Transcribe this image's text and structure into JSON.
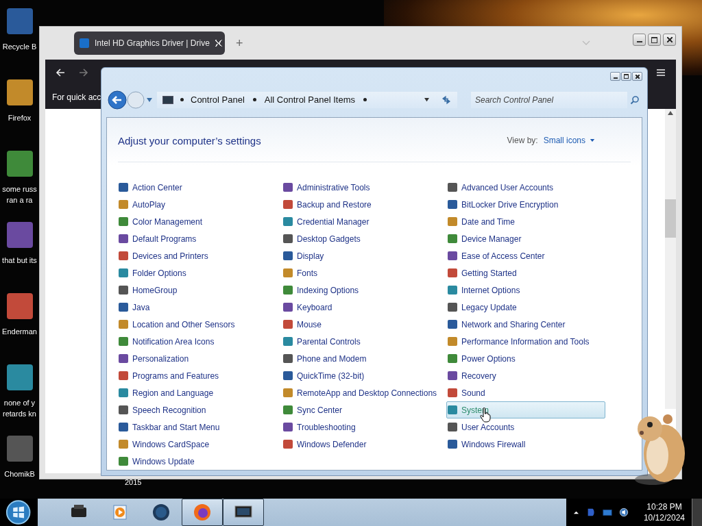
{
  "desktop": {
    "icons": [
      {
        "label": "Recycle B"
      },
      {
        "label": "Firefox"
      },
      {
        "label": "some russ\nran a ra"
      },
      {
        "label": "that but its"
      },
      {
        "label": "Enderman"
      },
      {
        "label": "none of y\nretards kn"
      },
      {
        "label": "ChomikB"
      }
    ],
    "partial_label": "2015"
  },
  "browser": {
    "tab": {
      "title": "Intel HD Graphics Driver | Drive"
    },
    "new_tab": "+",
    "page_text": "For quick acc"
  },
  "control_panel": {
    "breadcrumb": [
      "Control Panel",
      "All Control Panel Items"
    ],
    "search": {
      "placeholder": "Search Control Panel"
    },
    "heading": "Adjust your computer’s settings",
    "view_by": {
      "label": "View by:",
      "value": "Small icons"
    },
    "columns": [
      {
        "items": [
          {
            "label": "Action Center",
            "selected": false
          },
          {
            "label": "AutoPlay",
            "selected": false
          },
          {
            "label": "Color Management",
            "selected": false
          },
          {
            "label": "Default Programs",
            "selected": false
          },
          {
            "label": "Devices and Printers",
            "selected": false
          },
          {
            "label": "Folder Options",
            "selected": false
          },
          {
            "label": "HomeGroup",
            "selected": false
          },
          {
            "label": "Java",
            "selected": false
          },
          {
            "label": "Location and Other Sensors",
            "selected": false
          },
          {
            "label": "Notification Area Icons",
            "selected": false
          },
          {
            "label": "Personalization",
            "selected": false
          },
          {
            "label": "Programs and Features",
            "selected": false
          },
          {
            "label": "Region and Language",
            "selected": false
          },
          {
            "label": "Speech Recognition",
            "selected": false
          },
          {
            "label": "Taskbar and Start Menu",
            "selected": false
          },
          {
            "label": "Windows CardSpace",
            "selected": false
          },
          {
            "label": "Windows Update",
            "selected": false
          }
        ]
      },
      {
        "items": [
          {
            "label": "Administrative Tools",
            "selected": false
          },
          {
            "label": "Backup and Restore",
            "selected": false
          },
          {
            "label": "Credential Manager",
            "selected": false
          },
          {
            "label": "Desktop Gadgets",
            "selected": false
          },
          {
            "label": "Display",
            "selected": false
          },
          {
            "label": "Fonts",
            "selected": false
          },
          {
            "label": "Indexing Options",
            "selected": false
          },
          {
            "label": "Keyboard",
            "selected": false
          },
          {
            "label": "Mouse",
            "selected": false
          },
          {
            "label": "Parental Controls",
            "selected": false
          },
          {
            "label": "Phone and Modem",
            "selected": false
          },
          {
            "label": "QuickTime (32-bit)",
            "selected": false
          },
          {
            "label": "RemoteApp and Desktop Connections",
            "selected": false
          },
          {
            "label": "Sync Center",
            "selected": false
          },
          {
            "label": "Troubleshooting",
            "selected": false
          },
          {
            "label": "Windows Defender",
            "selected": false
          }
        ]
      },
      {
        "items": [
          {
            "label": "Advanced User Accounts",
            "selected": false
          },
          {
            "label": "BitLocker Drive Encryption",
            "selected": false
          },
          {
            "label": "Date and Time",
            "selected": false
          },
          {
            "label": "Device Manager",
            "selected": false
          },
          {
            "label": "Ease of Access Center",
            "selected": false
          },
          {
            "label": "Getting Started",
            "selected": false
          },
          {
            "label": "Internet Options",
            "selected": false
          },
          {
            "label": "Legacy Update",
            "selected": false
          },
          {
            "label": "Network and Sharing Center",
            "selected": false
          },
          {
            "label": "Performance Information and Tools",
            "selected": false
          },
          {
            "label": "Power Options",
            "selected": false
          },
          {
            "label": "Recovery",
            "selected": false
          },
          {
            "label": "Sound",
            "selected": false
          },
          {
            "label": "System",
            "selected": true
          },
          {
            "label": "User Accounts",
            "selected": false
          },
          {
            "label": "Windows Firewall",
            "selected": false
          }
        ]
      }
    ]
  },
  "taskbar": {
    "apps": [
      {
        "kind": "printer",
        "active": false
      },
      {
        "kind": "media",
        "active": false
      },
      {
        "kind": "globe",
        "active": false
      },
      {
        "kind": "firefox",
        "active": true
      },
      {
        "kind": "monitor",
        "active": true
      }
    ],
    "time": "10:28 PM",
    "date": "10/12/2024"
  }
}
